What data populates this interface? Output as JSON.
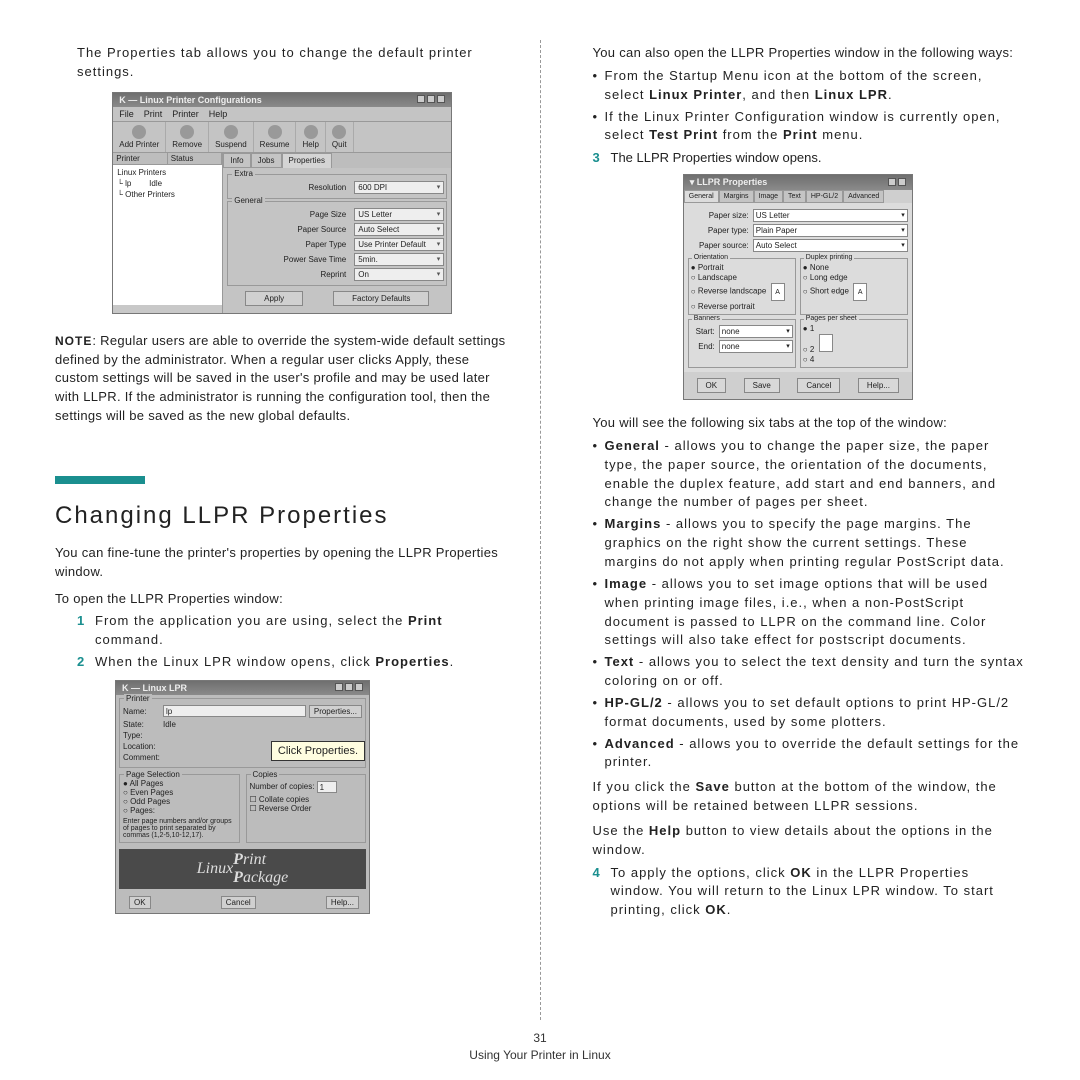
{
  "left": {
    "intro": "The Properties tab allows you to change the default printer settings.",
    "fig1": {
      "title": "Linux Printer Configurations",
      "menus": [
        "File",
        "Print",
        "Printer",
        "Help"
      ],
      "toolbar": [
        "Add Printer",
        "Remove",
        "Suspend",
        "Resume",
        "Help",
        "Quit"
      ],
      "cols": [
        "Printer",
        "Status"
      ],
      "printers": [
        {
          "name": "Linux Printers",
          "status": ""
        },
        {
          "name": "  └ lp",
          "status": "Idle"
        },
        {
          "name": "  └ Other Printers",
          "status": ""
        }
      ],
      "tabs": [
        "Info",
        "Jobs",
        "Properties"
      ],
      "group1": "Extra",
      "rows": [
        {
          "label": "Resolution",
          "value": "600 DPI"
        }
      ],
      "group2": "General",
      "rows2": [
        {
          "label": "Page Size",
          "value": "US Letter"
        },
        {
          "label": "Paper Source",
          "value": "Auto Select"
        },
        {
          "label": "Paper Type",
          "value": "Use Printer Default"
        },
        {
          "label": "Power Save Time",
          "value": "5min."
        },
        {
          "label": "Reprint",
          "value": "On"
        }
      ],
      "apply": "Apply",
      "factory": "Factory Defaults"
    },
    "note_label": "NOTE",
    "note": ": Regular users are able to override the system-wide default settings defined by the administrator. When a regular user clicks Apply, these custom settings will be saved in the user's profile and may be used later with LLPR. If the administrator is running the configuration tool, then the settings will be saved as the new global defaults.",
    "heading": "Changing LLPR Properties",
    "para1": "You can fine-tune the printer's properties by opening the LLPR Properties window.",
    "para2": "To open the LLPR Properties window:",
    "step1": "From the application you are using, select the Print command.",
    "step2": "When the Linux LPR window opens, click Properties.",
    "fig2": {
      "title": "Linux LPR",
      "printer": "Printer",
      "name": "Name:",
      "name_val": "lp",
      "props": "Properties...",
      "state": "State:",
      "state_val": "Idle",
      "type": "Type:",
      "loc": "Location:",
      "cmt": "Comment:",
      "ps": "Page Selection",
      "copies": "Copies",
      "all": "All Pages",
      "even": "Even Pages",
      "odd": "Odd Pages",
      "pages": "Pages:",
      "ncopies": "Number of copies:",
      "nval": "1",
      "collate": "Collate copies",
      "rev": "Reverse Order",
      "hint": "Enter page numbers and/or groups of pages to print separated by commas (1,2-5,10-12,17).",
      "brand": "Linux Print Package",
      "ok": "OK",
      "cancel": "Cancel",
      "help": "Help...",
      "callout": "Click Properties."
    }
  },
  "right": {
    "intro": "You can also open the LLPR Properties window in the following ways:",
    "b1": "From the Startup Menu icon at the bottom of the screen, select Linux Printer, and then Linux LPR.",
    "b2": "If the Linux Printer Configuration window is currently open, select Test Print from the Print menu.",
    "step3": "The LLPR Properties window opens.",
    "fig3": {
      "title": "LLPR Properties",
      "tabs": [
        "General",
        "Margins",
        "Image",
        "Text",
        "HP-GL/2",
        "Advanced"
      ],
      "psize_l": "Paper size:",
      "psize": "US Letter",
      "ptype_l": "Paper type:",
      "ptype": "Plain Paper",
      "psrc_l": "Paper source:",
      "psrc": "Auto Select",
      "orient": "Orientation",
      "duplex": "Duplex printing",
      "o1": "Portrait",
      "o2": "Landscape",
      "o3": "Reverse landscape",
      "o4": "Reverse portrait",
      "d1": "None",
      "d2": "Long edge",
      "d3": "Short edge",
      "banners": "Banners",
      "pps": "Pages per sheet",
      "start": "Start:",
      "end": "End:",
      "none": "none",
      "p1": "1",
      "p2": "2",
      "p4": "4",
      "ok": "OK",
      "save": "Save",
      "cancel": "Cancel",
      "help": "Help..."
    },
    "after1": "You will see the following six tabs at the top of the window:",
    "t1a": "General",
    "t1b": " - allows you to change the paper size, the paper type, the paper source, the orientation of the documents, enable the duplex feature, add start and end banners, and change the number of pages per sheet.",
    "t2a": "Margins",
    "t2b": " - allows you to specify the page margins. The graphics on the right show the current settings. These margins do not apply when printing regular PostScript data.",
    "t3a": "Image",
    "t3b": " - allows you to set image options that will be used when printing image files, i.e., when a non-PostScript document is passed to LLPR on the command line. Color settings will also take effect for postscript documents.",
    "t4a": "Text",
    "t4b": " - allows you to select the text density and turn the syntax coloring on or off.",
    "t5a": "HP-GL/2",
    "t5b": " - allows you to set default options to print HP-GL/2 format documents, used by some plotters.",
    "t6a": "Advanced",
    "t6b": " - allows you to override the default settings for the printer.",
    "p_save": "If you click the Save button at the bottom of the window, the options will be retained between LLPR sessions.",
    "p_help": "Use the Help button to view details about the options in the window.",
    "step4": "To apply the options, click OK in the LLPR Properties window. You will return to the Linux LPR window. To start printing, click OK.",
    "pagenum": "31",
    "footer": "Using Your Printer in Linux"
  }
}
